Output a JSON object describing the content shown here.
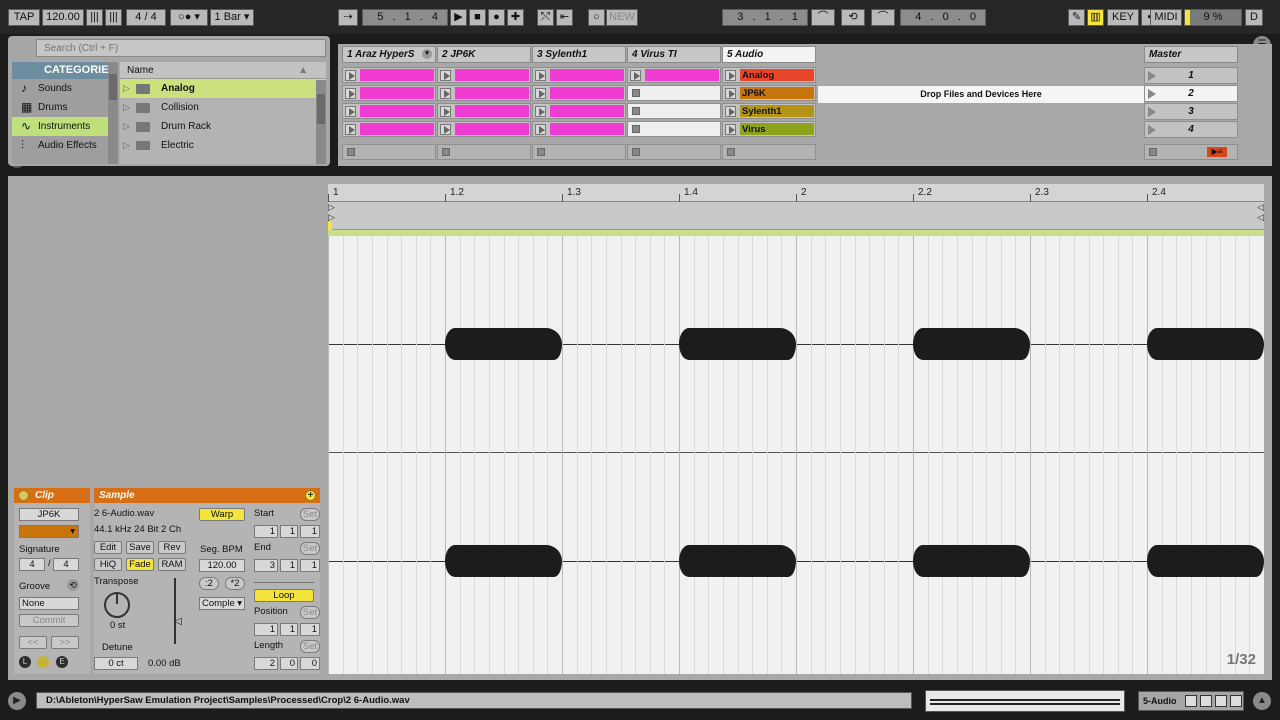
{
  "transport": {
    "tap_label": "TAP",
    "tempo": "120.00",
    "time_signature": "4 / 4",
    "quantize": "1 Bar",
    "song_position": "5 .  1 .  4",
    "new_label": "NEW",
    "loop_start": "3 .  1 .  1",
    "loop_length": "4 .  0 .  0",
    "key_label": "KEY",
    "midi_label": "MIDI",
    "cpu_load": "9 %",
    "cpu_fraction": 0.09,
    "d_label": "D"
  },
  "browser": {
    "search_placeholder": "Search (Ctrl + F)",
    "categories_header": "CATEGORIES",
    "categories": [
      {
        "label": "Sounds",
        "icon": "note-icon"
      },
      {
        "label": "Drums",
        "icon": "grid-icon"
      },
      {
        "label": "Instruments",
        "icon": "wave-icon"
      },
      {
        "label": "Audio Effects",
        "icon": "knobs-icon"
      }
    ],
    "name_header": "Name",
    "files": [
      "Analog",
      "Collision",
      "Drum Rack",
      "Electric"
    ]
  },
  "session": {
    "tracks": [
      {
        "name": "1 Araz HyperS"
      },
      {
        "name": "2 JP6K"
      },
      {
        "name": "3 Sylenth1"
      },
      {
        "name": "4 Virus TI"
      },
      {
        "name": "5 Audio"
      }
    ],
    "audio_clips": [
      {
        "label": "Analog",
        "color": "#e8452a"
      },
      {
        "label": "JP6K",
        "color": "#c8750b"
      },
      {
        "label": "Sylenth1",
        "color": "#b49414"
      },
      {
        "label": "Virus",
        "color": "#8ea21c"
      }
    ],
    "clip_color_pink": "#f03cd3",
    "drop_label": "Drop Files and Devices Here",
    "master_label": "Master",
    "scenes": [
      "1",
      "2",
      "3",
      "4"
    ]
  },
  "clip": {
    "title": "Clip",
    "name": "JP6K",
    "signature_label": "Signature",
    "sig_num": "4",
    "sig_den": "4",
    "groove_label": "Groove",
    "groove_value": "None",
    "commit_label": "Commit",
    "nav_prev": "<<",
    "nav_next": ">>",
    "l_label": "L",
    "e_label": "E"
  },
  "sample": {
    "title": "Sample",
    "file": "2 6-Audio.wav",
    "format": "44.1 kHz 24 Bit 2 Ch",
    "edit": "Edit",
    "save": "Save",
    "rev": "Rev",
    "hiq": "HiQ",
    "fade": "Fade",
    "ram": "RAM",
    "transpose_label": "Transpose",
    "transpose_value": "0 st",
    "detune_label": "Detune",
    "detune_value": "0 ct",
    "gain_value": "0.00 dB",
    "warp": "Warp",
    "seg_bpm_label": "Seg. BPM",
    "seg_bpm": "120.00",
    "half": ":2",
    "double": "*2",
    "warp_mode": "Comple",
    "start_label": "Start",
    "start": [
      "1",
      "1",
      "1"
    ],
    "end_label": "End",
    "end": [
      "3",
      "1",
      "1"
    ],
    "loop": "Loop",
    "position_label": "Position",
    "position": [
      "1",
      "1",
      "1"
    ],
    "length_label": "Length",
    "length": [
      "2",
      "0",
      "0"
    ],
    "set_label": "Set"
  },
  "waveform": {
    "ruler": [
      "1",
      "1.2",
      "1.3",
      "1.4",
      "2",
      "2.2",
      "2.3",
      "2.4"
    ],
    "zoom": "1/32"
  },
  "status": {
    "path": "D:\\Ableton\\HyperSaw Emulation Project\\Samples\\Processed\\Crop\\2 6-Audio.wav",
    "track_selector": "5-Audio"
  }
}
